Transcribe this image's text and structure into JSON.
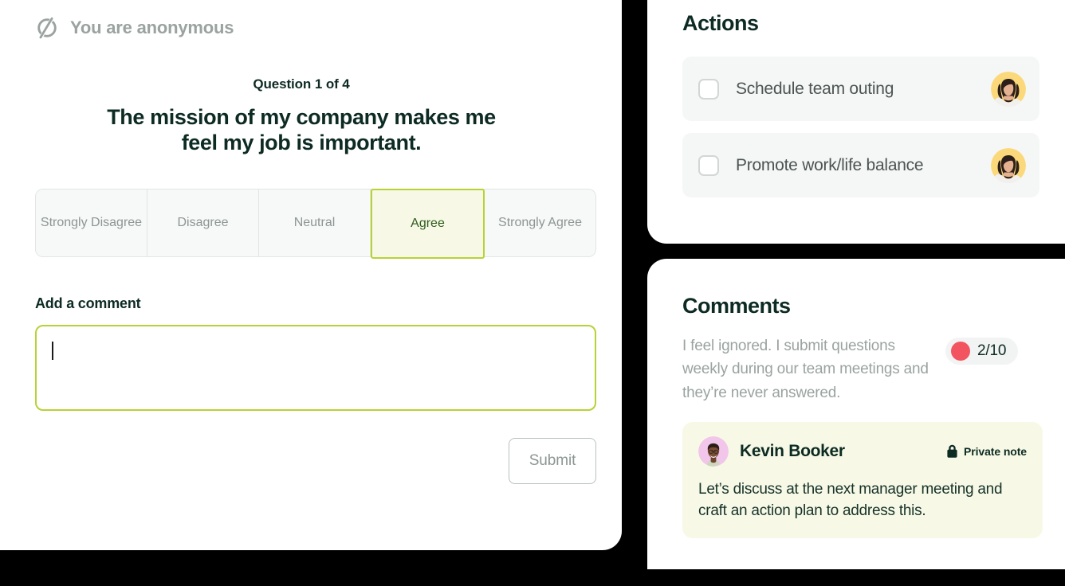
{
  "survey": {
    "anonymous_icon": "eye-off-icon",
    "anonymous_label": "You are anonymous",
    "question_counter": "Question 1 of 4",
    "question_text": "The mission of my company makes me feel my job is important.",
    "scale": {
      "options": [
        {
          "label": "Strongly Disagree",
          "selected": false
        },
        {
          "label": "Disagree",
          "selected": false
        },
        {
          "label": "Neutral",
          "selected": false
        },
        {
          "label": "Agree",
          "selected": true
        },
        {
          "label": "Strongly Agree",
          "selected": false
        }
      ],
      "selected_value": "Agree"
    },
    "comment": {
      "label": "Add a comment",
      "value": "",
      "placeholder": ""
    },
    "submit_label": "Submit"
  },
  "actions": {
    "title": "Actions",
    "items": [
      {
        "label": "Schedule team outing",
        "checked": false,
        "assignee_avatar": "woman-avatar"
      },
      {
        "label": "Promote work/life balance",
        "checked": false,
        "assignee_avatar": "woman-avatar"
      }
    ]
  },
  "comments": {
    "title": "Comments",
    "quote": "I feel ignored. I submit questions weekly during our team meetings and they’re never answered.",
    "score": {
      "value": "2/10",
      "dot_color": "#f2555f"
    },
    "note": {
      "author": "Kevin Booker",
      "author_avatar": "man-avatar",
      "privacy_icon": "lock-icon",
      "privacy_label": "Private note",
      "text": "Let’s discuss at the next manager meeting and craft an action plan to address this."
    }
  },
  "theme": {
    "accent": "#b6d335",
    "accent_soft": "#f7f9e6",
    "ink": "#0d2b23",
    "muted": "#9aa3a0",
    "page_bg": "#000000"
  }
}
